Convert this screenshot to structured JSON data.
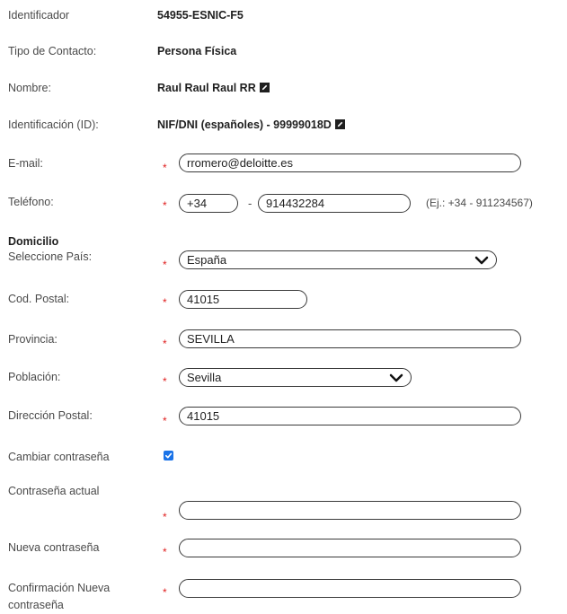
{
  "fields": {
    "identificador": {
      "label": "Identificador",
      "value": "54955-ESNIC-F5"
    },
    "tipo_contacto": {
      "label": "Tipo de Contacto:",
      "value": "Persona Física"
    },
    "nombre": {
      "label": "Nombre:",
      "value": "Raul Raul Raul RR"
    },
    "identificacion": {
      "label": "Identificación (ID):",
      "value": "NIF/DNI (españoles) - 99999018D"
    },
    "email": {
      "label": "E-mail:",
      "value": "rromero@deloitte.es"
    },
    "telefono": {
      "label": "Teléfono:",
      "prefix": "+34",
      "dash": "-",
      "number": "914432284",
      "hint": "(Ej.: +34 - 911234567)"
    }
  },
  "domicilio": {
    "title": "Domicilio",
    "pais": {
      "label": "Seleccione País:",
      "selected": "España"
    },
    "cod_postal": {
      "label": "Cod. Postal:",
      "value": "41015"
    },
    "provincia": {
      "label": "Provincia:",
      "value": "SEVILLA"
    },
    "poblacion": {
      "label": "Población:",
      "selected": "Sevilla"
    },
    "direccion": {
      "label": "Dirección Postal:",
      "value": "41015"
    }
  },
  "password": {
    "change_label": "Cambiar contraseña",
    "change_checked": true,
    "actual_label": "Contraseña actual",
    "nueva_label": "Nueva contraseña",
    "confirm_label_1": "Confirmación Nueva",
    "confirm_label_2": "contraseña"
  },
  "required_mark": "*",
  "colors": {
    "required": "#e02020",
    "checkbox": "#1a73e8",
    "border": "#3a3a3a"
  },
  "icons": {
    "edit": "pencil-edit-icon",
    "dropdown": "chevron-down-icon",
    "check": "check-icon"
  }
}
